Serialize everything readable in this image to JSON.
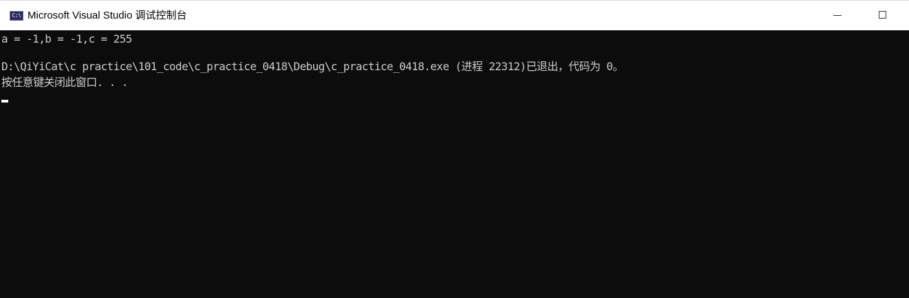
{
  "window": {
    "title": "Microsoft Visual Studio 调试控制台",
    "icon": "console-app-icon",
    "icon_text": "C:\\",
    "controls": {
      "minimize": "minimize-icon",
      "maximize": "maximize-icon"
    }
  },
  "console": {
    "lines": [
      "a = -1,b = -1,c = 255",
      "",
      "D:\\QiYiCat\\c practice\\101_code\\c_practice_0418\\Debug\\c_practice_0418.exe (进程 22312)已退出，代码为 0。",
      "按任意键关闭此窗口. . ."
    ]
  },
  "colors": {
    "console_bg": "#0c0c0c",
    "console_fg": "#cccccc",
    "titlebar_bg": "#ffffff",
    "cursor": "#ffffff"
  }
}
